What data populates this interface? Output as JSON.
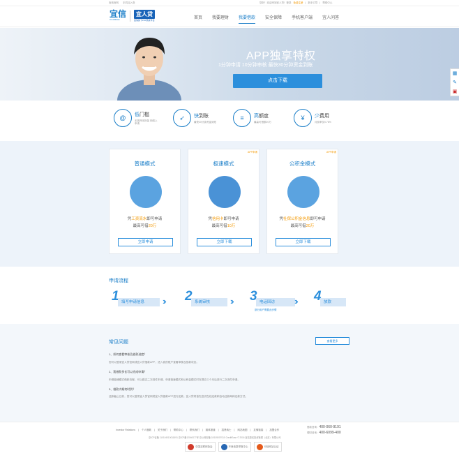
{
  "topbar": {
    "left": [
      "宜信官网",
      "手机加入券"
    ],
    "right": [
      "您好！欢迎来到宜人贷！登录",
      "免费注册",
      "新手引导",
      "帮助中心"
    ]
  },
  "logo": {
    "brand": "宜信",
    "brand_en": "CreditEase",
    "product": "宜人贷",
    "slogan": "宜信旗下P2P借贷平台"
  },
  "nav": {
    "items": [
      "首页",
      "我要理财",
      "我要借款",
      "安全保障",
      "手机客户端",
      "宜人问答"
    ],
    "active_index": 2
  },
  "banner": {
    "title": "APP独享特权",
    "subtitle": "1分钟申请  10分钟审核  最快30分钟资金到账",
    "button": "点击下载"
  },
  "features": [
    {
      "icon": "doorway-icon",
      "title_hl": "低",
      "title": "门槛",
      "desc": "无抵押无担保 网络上申请"
    },
    {
      "icon": "rocket-icon",
      "title_hl": "快",
      "title": "到账",
      "desc": "最快30分钟资金到账"
    },
    {
      "icon": "coins-icon",
      "title_hl": "高",
      "title": "额度",
      "desc": "最高可借额20万"
    },
    {
      "icon": "yuan-icon",
      "title_hl": "少",
      "title": "费用",
      "desc": "月费率仅0.78%"
    }
  ],
  "modes": [
    {
      "tag": "",
      "title": "普通模式",
      "line1_pre": "凭",
      "line1_hl": "工资流水",
      "line1_post": "即可申请",
      "line2_pre": "最高可借",
      "line2_hl": "20万",
      "button": "立即申请"
    },
    {
      "tag": "APP申请",
      "title": "极速模式",
      "line1_pre": "凭",
      "line1_hl": "信用卡",
      "line1_post": "即可申请",
      "line2_pre": "最高可借",
      "line2_hl": "10万",
      "button": "立即下载"
    },
    {
      "tag": "APP申请",
      "title": "公积金模式",
      "line1_pre": "凭",
      "line1_hl": "社保公积金信息",
      "line1_post": "即可申请",
      "line2_pre": "最高可借",
      "line2_hl": "20万",
      "button": "立即下载"
    }
  ],
  "flow": {
    "title": "申请流程",
    "steps": [
      {
        "num": "1",
        "label": "填写申请信息"
      },
      {
        "num": "2",
        "label": "系统审核"
      },
      {
        "num": "3",
        "label": "电话回访",
        "note": "部分用户需要此步骤"
      },
      {
        "num": "4",
        "label": "放款"
      }
    ]
  },
  "faq": {
    "title": "常见问题",
    "more": "查看更多",
    "items": [
      {
        "q": "1、如何查看审核及放款进度？",
        "a": "您可以登录宜人贷官网或宜人贷借款APP，进入我的账户查看审核及放款状态。"
      },
      {
        "q": "2、我借款多长可以完成申请？",
        "a": "申请普通模式借款流程，可以跳过二次进件申请。申请极速模式和公积金模式时在提交三个月后进行二次进件申请。"
      },
      {
        "q": "3、借款大概何时到？",
        "a": "还款截止日前，您可以登录宜人贷官网或宜人贷借款APP进行还款。宜人贷将首先尝试在线还款和自动还款两种还款方式。"
      }
    ]
  },
  "footer": {
    "links": [
      "Investor Relations",
      "个人借款",
      "关于我们",
      "帮助中心",
      "联系我们",
      "媒体报道",
      "招贤纳士",
      "网站地图",
      "友情链接",
      "加盟合作"
    ],
    "copyright": "京ICP证备 110104010011691 京ICP备12040077号 京公网安备110105007010 CreditEase © 2016 宜信惠民投资管理（北京）有限公司",
    "phone1_label": "借款咨询：",
    "phone1": "400-060-9191",
    "phone2_label": "理财咨询：",
    "phone2": "400-6099-400",
    "badges": [
      "中国互联网协会",
      "不良信息举报中心",
      "可信网站认证"
    ]
  }
}
